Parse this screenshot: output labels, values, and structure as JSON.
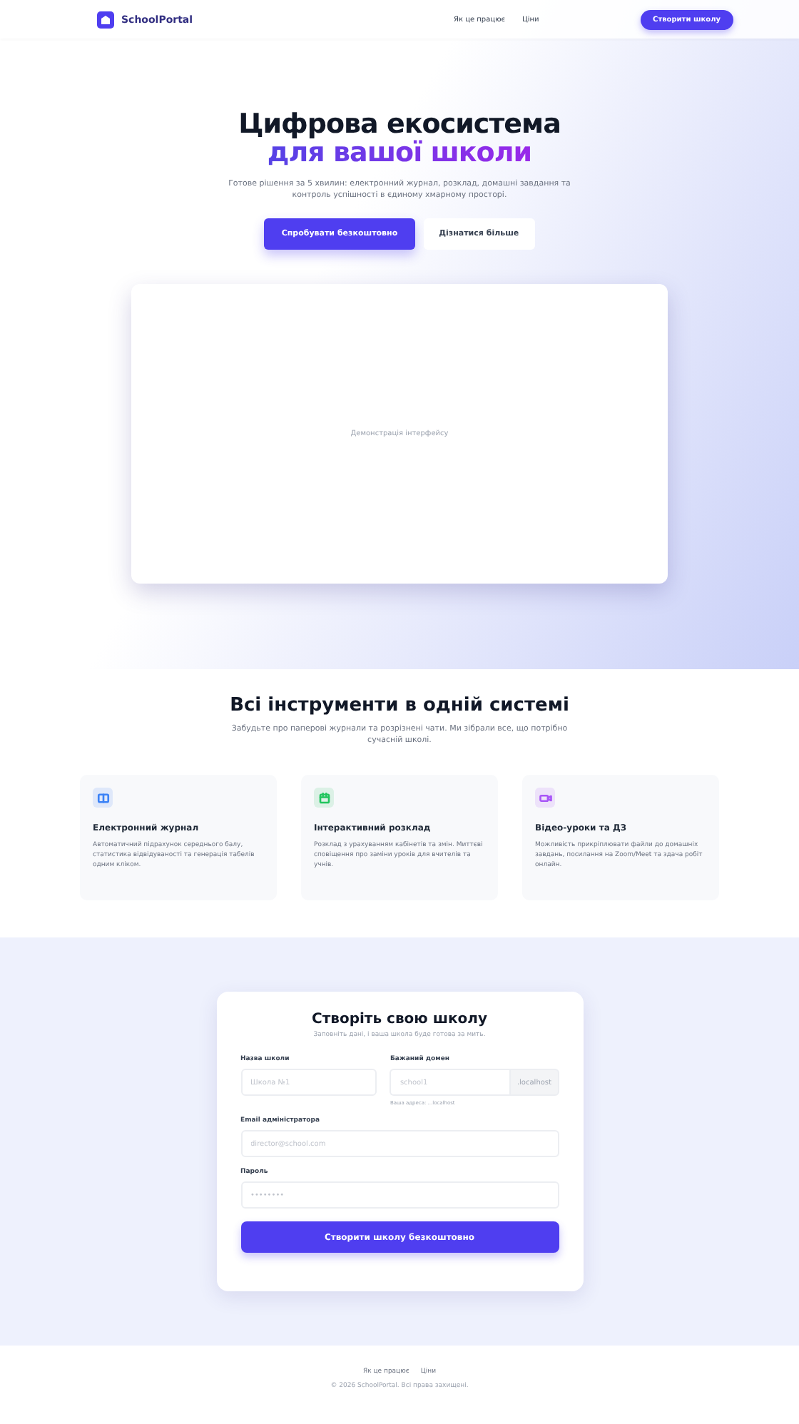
{
  "nav": {
    "brand": "SchoolPortal",
    "links": [
      "Як це працює",
      "Ціни"
    ],
    "cta": "Створити школу"
  },
  "hero": {
    "title_line1": "Цифрова екосистема",
    "title_line2": "для вашої школи",
    "subtitle": "Готове рішення за 5 хвилин: електронний журнал, розклад, домашні завдання та контроль успішності в єдиному хмарному просторі.",
    "primary_button": "Спробувати безкоштовно",
    "secondary_button": "Дізнатися більше",
    "demo_label": "Демонстрація інтерфейсу"
  },
  "features": {
    "title": "Всі інструменти в одній системі",
    "subtitle": "Забудьте про паперові журнали та розрізнені чати. Ми зібрали все, що потрібно сучасній школі.",
    "items": [
      {
        "kind": "book",
        "color": "#3b82f6",
        "title": "Електронний журнал",
        "text": "Автоматичний підрахунок середнього балу, статистика відвідуваності та генерація табелів одним кліком."
      },
      {
        "kind": "calendar",
        "color": "#22c55e",
        "title": "Інтерактивний розклад",
        "text": "Розклад з урахуванням кабінетів та змін. Миттєві сповіщення про заміни уроків для вчителів та учнів."
      },
      {
        "kind": "video",
        "color": "#a855f7",
        "title": "Відео-уроки та ДЗ",
        "text": "Можливість прикріплювати файли до домашніх завдань, посилання на Zoom/Meet та здача робіт онлайн."
      }
    ]
  },
  "form": {
    "title": "Створіть свою школу",
    "subtitle": "Заповніть дані, і ваша школа буде готова за мить.",
    "school_name": {
      "label": "Назва школи",
      "placeholder": "Школа №1"
    },
    "domain": {
      "label": "Бажаний домен",
      "placeholder": "school1",
      "suffix": ".localhost",
      "hint": "Ваша адреса: ...localhost"
    },
    "email": {
      "label": "Email адміністратора",
      "placeholder": "director@school.com"
    },
    "password": {
      "label": "Пароль",
      "placeholder": "••••••••"
    },
    "submit": "Створити школу безкоштовно"
  },
  "footer": {
    "links": [
      "Як це працює",
      "Ціни"
    ],
    "copyright": "© 2026 SchoolPortal. Всі права захищені."
  }
}
